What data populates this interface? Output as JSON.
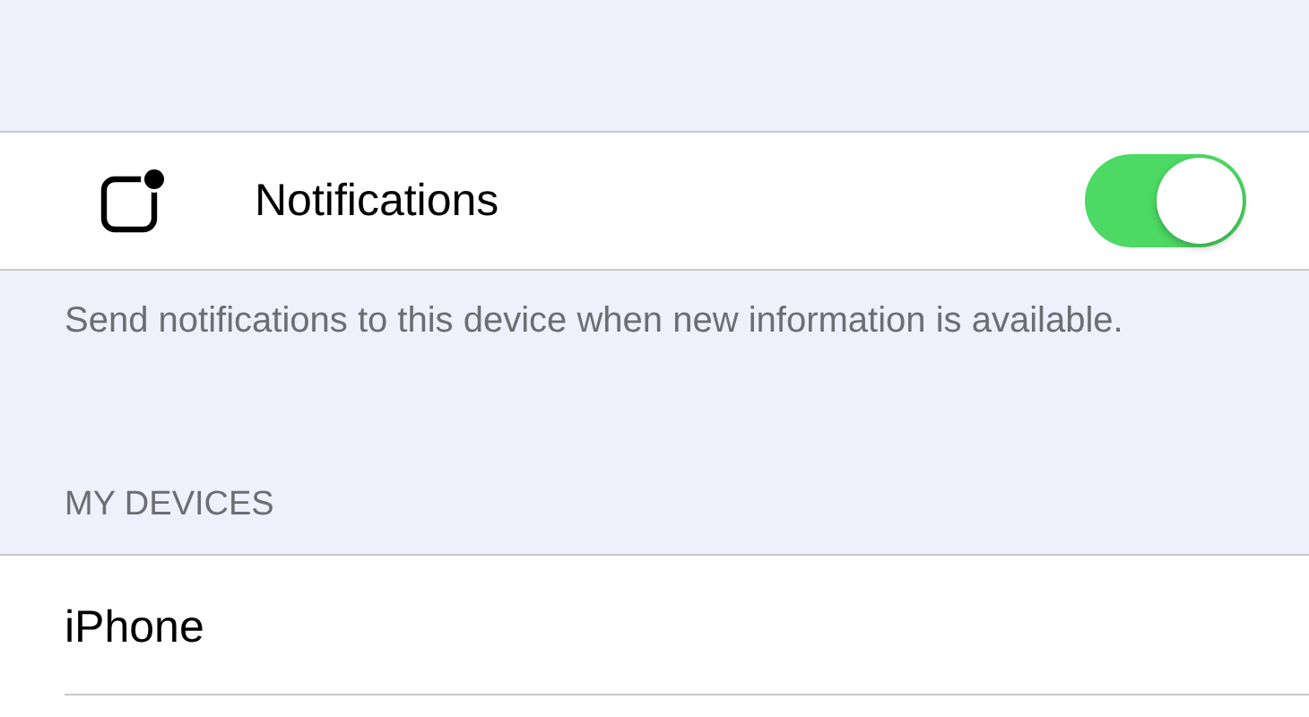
{
  "notifications": {
    "label": "Notifications",
    "on": true
  },
  "footer": "Send notifications to this device when new information is available.",
  "section_header": "MY DEVICES",
  "devices": [
    {
      "name": "iPhone"
    }
  ]
}
